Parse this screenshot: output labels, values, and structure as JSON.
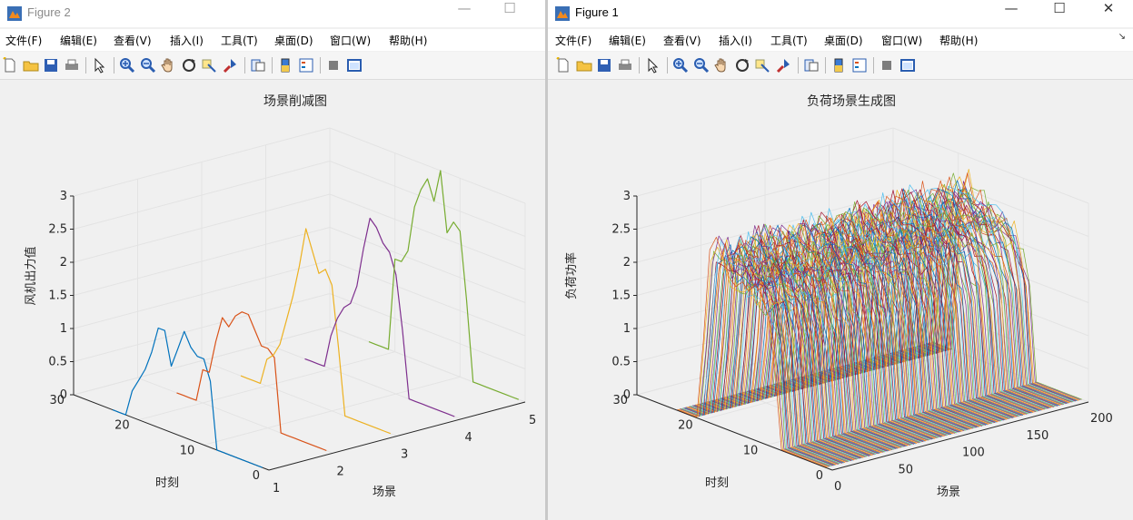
{
  "left_window": {
    "title": "Figure 2",
    "menu": [
      "文件(F)",
      "编辑(E)",
      "查看(V)",
      "插入(I)",
      "工具(T)",
      "桌面(D)",
      "窗口(W)",
      "帮助(H)"
    ],
    "controls": {
      "minimize": "—",
      "maximize": "☐"
    }
  },
  "right_window": {
    "title": "Figure 1",
    "menu": [
      "文件(F)",
      "编辑(E)",
      "查看(V)",
      "插入(I)",
      "工具(T)",
      "桌面(D)",
      "窗口(W)",
      "帮助(H)"
    ],
    "controls": {
      "minimize": "—",
      "maximize": "☐",
      "close": "✕"
    }
  },
  "chart_data": [
    {
      "type": "line",
      "title": "场景削减图",
      "xlabel": "场景",
      "ylabel": "时刻",
      "zlabel": "风机出力值",
      "xlim": [
        1,
        5
      ],
      "ylim": [
        0,
        30
      ],
      "zlim": [
        0,
        3
      ],
      "xticks": [
        "1",
        "2",
        "3",
        "4",
        "5"
      ],
      "yticks": [
        "0",
        "10",
        "20",
        "30"
      ],
      "zticks": [
        "0",
        "0.5",
        "1",
        "1.5",
        "2",
        "2.5",
        "3"
      ],
      "x": [
        1,
        2,
        3,
        4,
        5,
        6,
        7,
        8,
        9,
        10,
        11,
        12,
        13,
        14,
        15,
        16,
        17,
        18,
        19,
        20,
        21,
        22,
        23,
        24
      ],
      "series": [
        {
          "scene": 1,
          "color": "#0072bd",
          "values": [
            0,
            0,
            0,
            0,
            0,
            0,
            0,
            0,
            1.0,
            1.3,
            1.3,
            1.4,
            1.6,
            1.3,
            1.0,
            1.5,
            1.5,
            1.1,
            0.8,
            0.6,
            0.4,
            0.0,
            0.0,
            0.0
          ]
        },
        {
          "scene": 2,
          "color": "#d95319",
          "values": [
            0,
            0,
            0,
            0,
            0,
            0,
            0,
            0,
            1.1,
            1.2,
            1.2,
            1.4,
            1.6,
            1.6,
            1.5,
            1.3,
            1.4,
            1.0,
            0.5,
            0.5,
            0.0,
            0.0,
            0.0,
            0.0
          ]
        },
        {
          "scene": 3,
          "color": "#edb120",
          "values": [
            0,
            0,
            0,
            0,
            0,
            0,
            0,
            0,
            1.0,
            1.9,
            2.1,
            2.0,
            2.3,
            2.6,
            2.0,
            1.5,
            1.1,
            0.7,
            0.5,
            0.4,
            0.0,
            0.0,
            0.0,
            0.0
          ]
        },
        {
          "scene": 4,
          "color": "#7e2f8e",
          "values": [
            0,
            0,
            0,
            0,
            0,
            0,
            0,
            0,
            1.0,
            1.8,
            2.1,
            2.2,
            2.4,
            2.5,
            2.0,
            1.4,
            1.1,
            1.0,
            0.8,
            0.5,
            0.0,
            0.0,
            0.0,
            0.0
          ]
        },
        {
          "scene": 5,
          "color": "#77ac30",
          "values": [
            0,
            0,
            0,
            0,
            0,
            0,
            0,
            0,
            1.2,
            2.2,
            2.3,
            2.1,
            3.0,
            2.5,
            2.8,
            2.6,
            2.3,
            1.6,
            1.4,
            1.4,
            0.0,
            0.0,
            0.0,
            0.0
          ]
        }
      ]
    },
    {
      "type": "line",
      "title": "负荷场景生成图",
      "xlabel": "场景",
      "ylabel": "时刻",
      "zlabel": "负荷功率",
      "xlim": [
        0,
        200
      ],
      "ylim": [
        0,
        30
      ],
      "zlim": [
        0,
        3
      ],
      "xticks": [
        "0",
        "50",
        "100",
        "150",
        "200"
      ],
      "yticks": [
        "0",
        "10",
        "20",
        "30"
      ],
      "zticks": [
        "0",
        "0.5",
        "1",
        "1.5",
        "2",
        "2.5",
        "3"
      ],
      "scene_count": 200,
      "x": [
        1,
        2,
        3,
        4,
        5,
        6,
        7,
        8,
        9,
        10,
        11,
        12,
        13,
        14,
        15,
        16,
        17,
        18,
        19,
        20,
        21,
        22,
        23,
        24
      ],
      "typical_profile": [
        0,
        0,
        0,
        0,
        0,
        0,
        0,
        0,
        1.4,
        1.9,
        2.1,
        2.2,
        2.3,
        2.3,
        2.3,
        2.4,
        2.5,
        2.6,
        2.4,
        1.1,
        0,
        0,
        0,
        0
      ],
      "colors": [
        "#0072bd",
        "#d95319",
        "#edb120",
        "#7e2f8e",
        "#77ac30",
        "#4dbeee",
        "#a2142f"
      ]
    }
  ]
}
